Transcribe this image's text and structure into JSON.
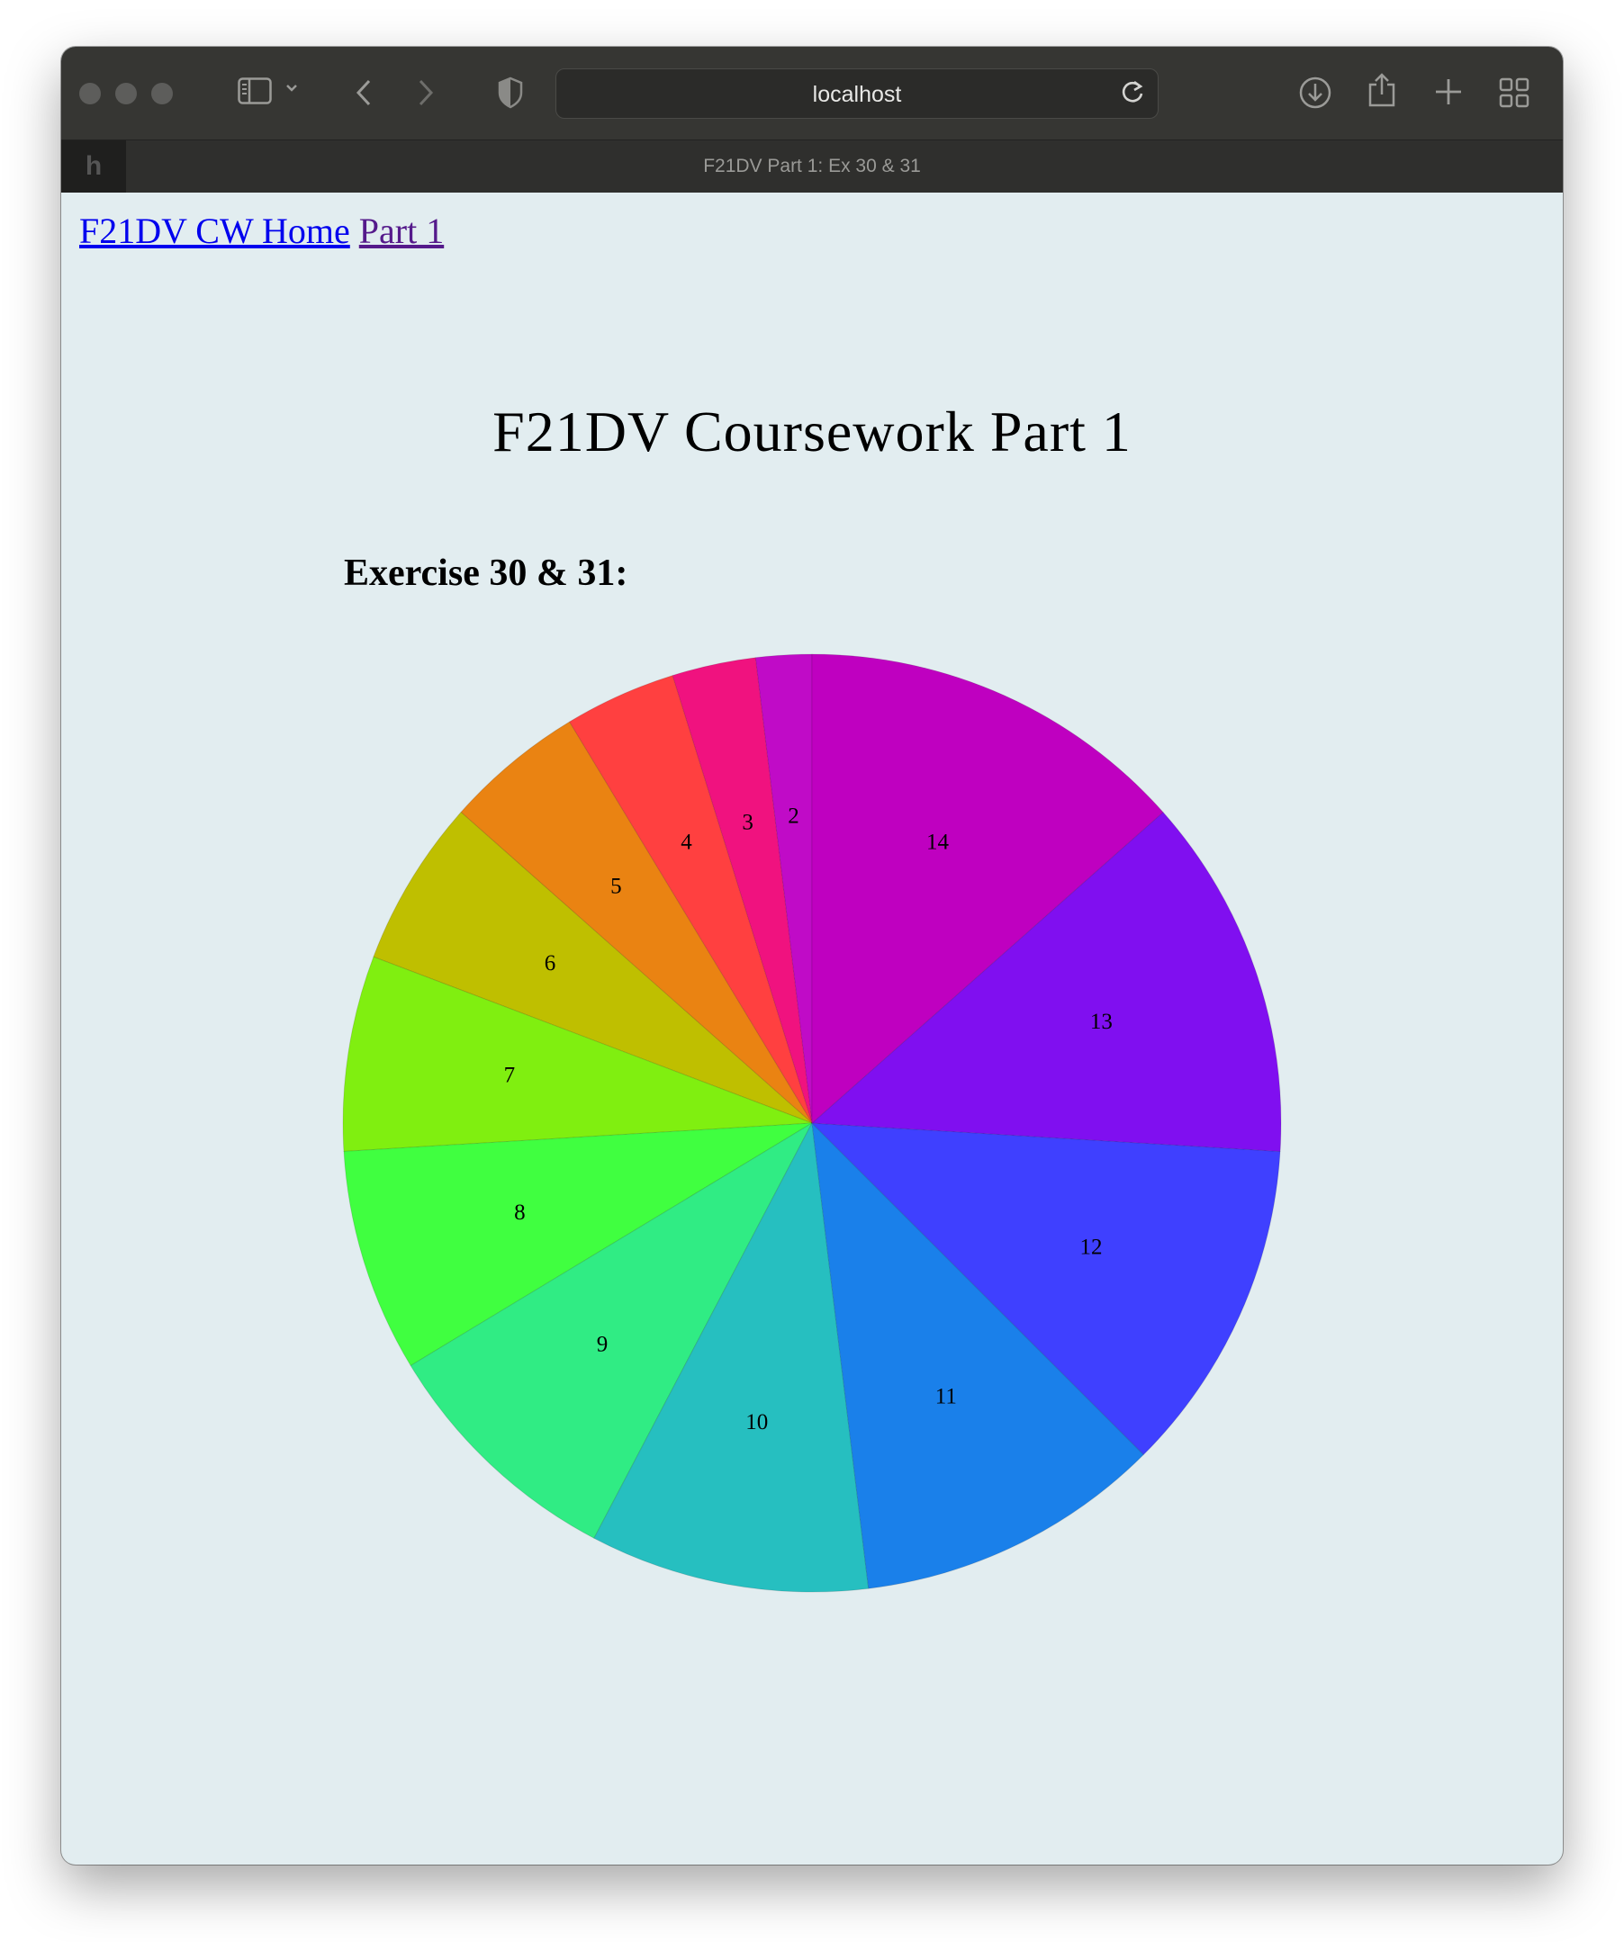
{
  "browser": {
    "url": "localhost",
    "tab_title": "F21DV Part 1: Ex 30 & 31",
    "tab_favicon": "h",
    "icons": [
      "sidebar-icon",
      "chevron-down-icon",
      "back-icon",
      "forward-icon",
      "shield-icon",
      "reload-icon",
      "download-icon",
      "share-icon",
      "new-tab-icon",
      "tab-overview-icon"
    ]
  },
  "nav": {
    "home_label": "F21DV CW Home",
    "part_label": "Part 1"
  },
  "page": {
    "title": "F21DV Coursework Part 1",
    "section_title": "Exercise 30 & 31:"
  },
  "chart_data": {
    "type": "pie",
    "values": [
      2,
      3,
      4,
      5,
      6,
      7,
      8,
      9,
      10,
      11,
      12,
      13,
      14
    ],
    "labels": [
      "2",
      "3",
      "4",
      "5",
      "6",
      "7",
      "8",
      "9",
      "10",
      "11",
      "12",
      "13",
      "14"
    ],
    "colors": {
      "2": "#c00bc7",
      "3": "#f0127f",
      "4": "#ff4040",
      "5": "#ea8312",
      "6": "#bfbf00",
      "7": "#80ef10",
      "8": "#40ff40",
      "9": "#30ec84",
      "10": "#26bfc0",
      "11": "#1a80ea",
      "12": "#3f40ff",
      "13": "#800ff0",
      "14": "#bf00c0"
    },
    "start": "12 o'clock",
    "direction": "counter-clockwise",
    "sorted": "ascending"
  }
}
